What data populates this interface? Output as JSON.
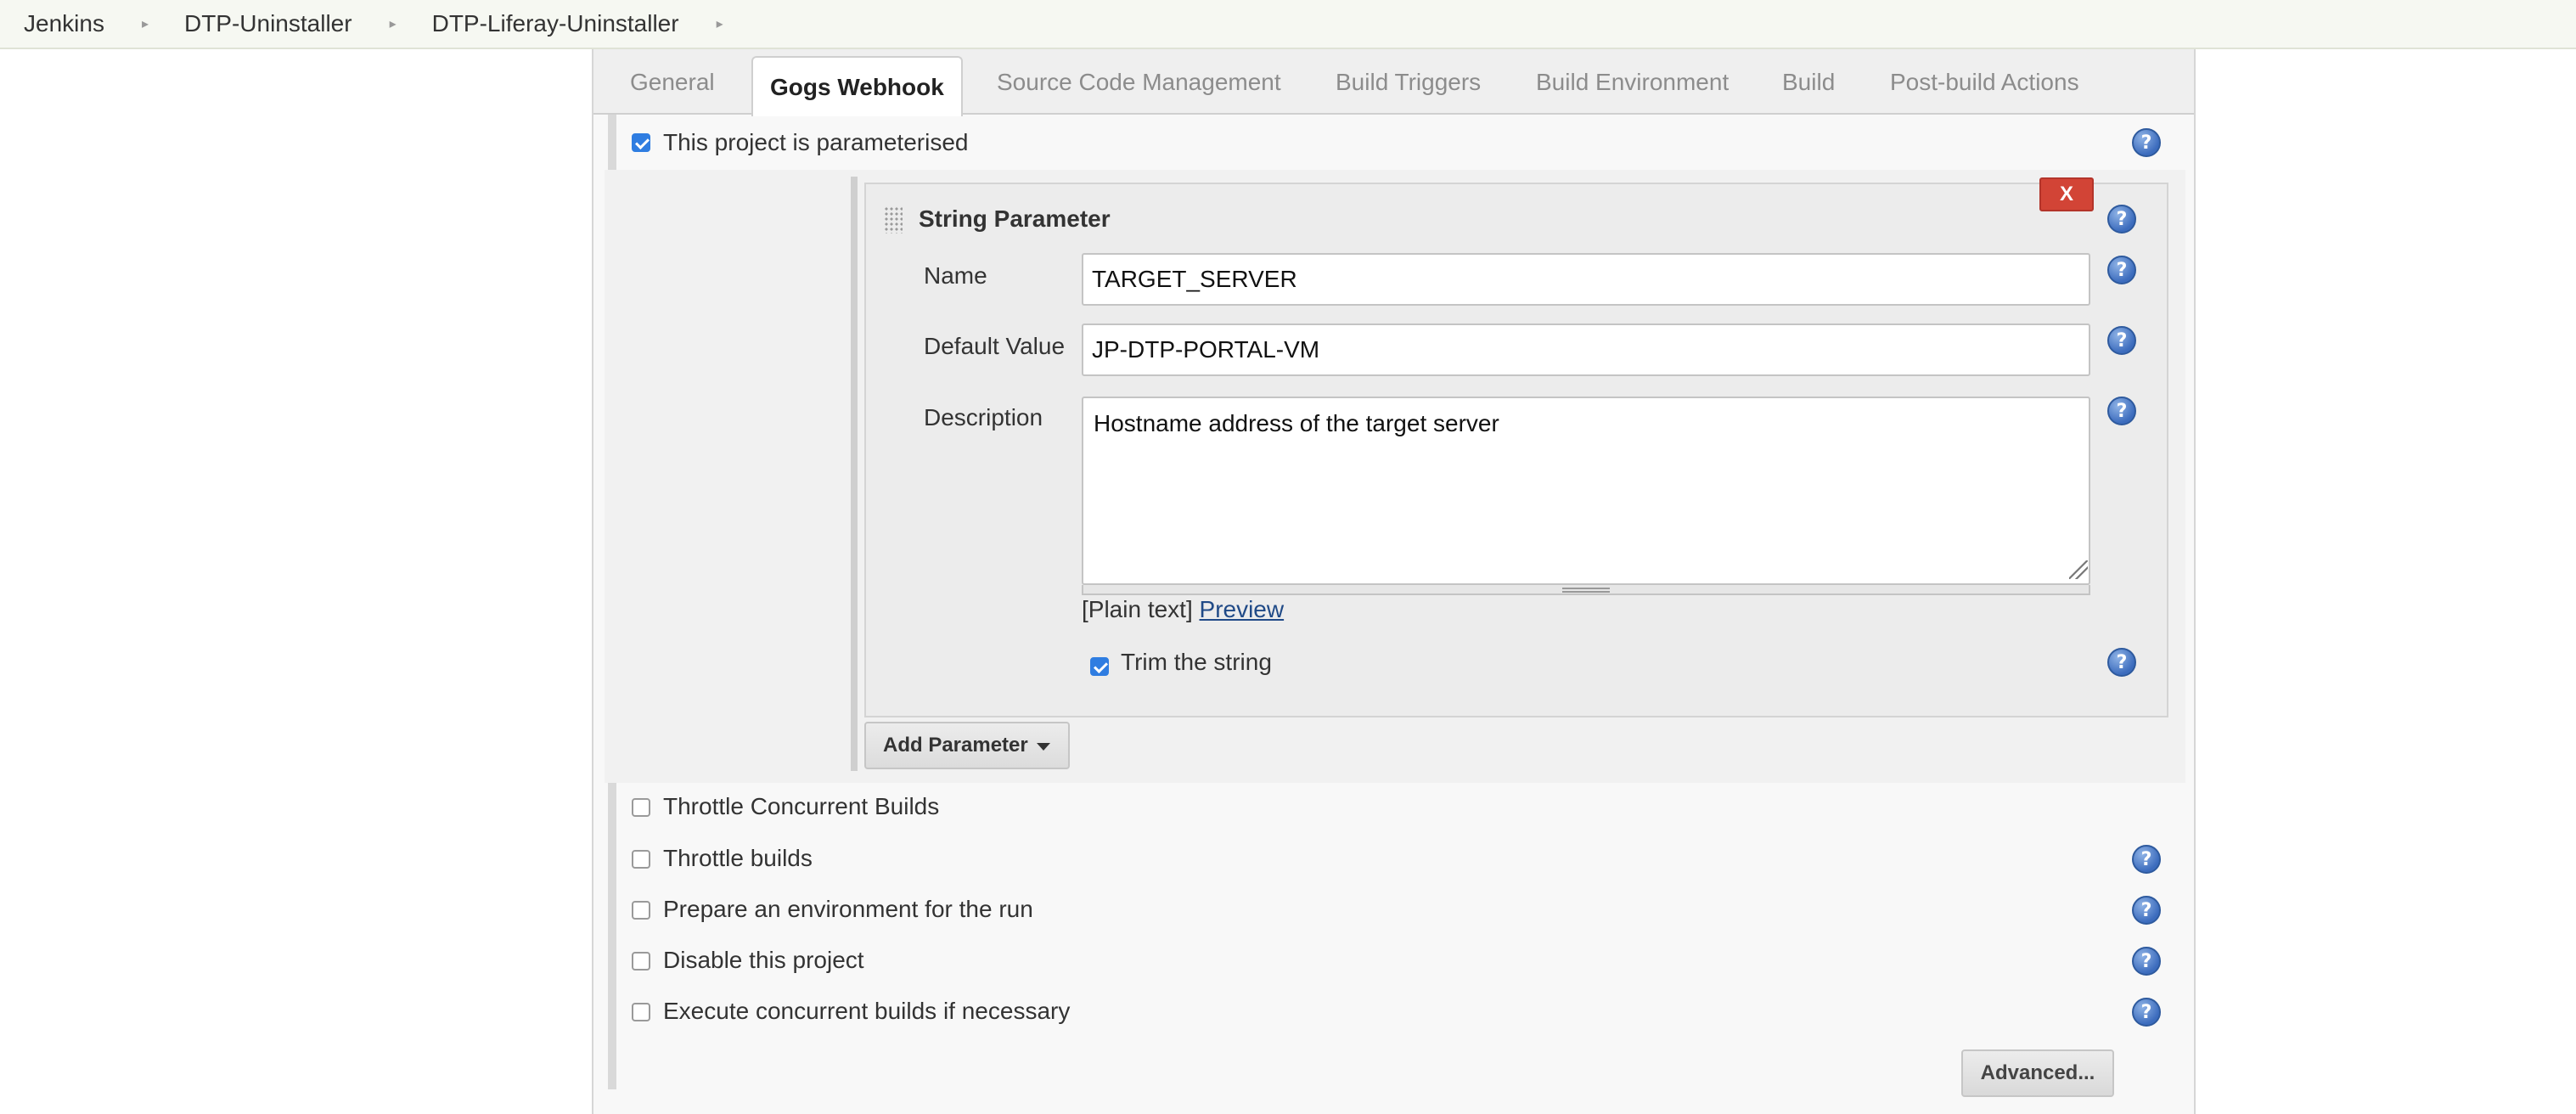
{
  "breadcrumb": {
    "items": [
      "Jenkins",
      "DTP-Uninstaller",
      "DTP-Liferay-Uninstaller"
    ],
    "separator": "▸"
  },
  "tabs": [
    {
      "label": "General",
      "active": false
    },
    {
      "label": "Gogs Webhook",
      "active": true
    },
    {
      "label": "Source Code Management",
      "active": false
    },
    {
      "label": "Build Triggers",
      "active": false
    },
    {
      "label": "Build Environment",
      "active": false
    },
    {
      "label": "Build",
      "active": false
    },
    {
      "label": "Post-build Actions",
      "active": false
    }
  ],
  "parameterised": {
    "label": "This project is parameterised",
    "checked": true
  },
  "string_parameter": {
    "title": "String Parameter",
    "delete_label": "X",
    "name_label": "Name",
    "name_value": "TARGET_SERVER",
    "default_label": "Default Value",
    "default_value": "JP-DTP-PORTAL-VM",
    "description_label": "Description",
    "description_value": "Hostname address of the target server",
    "plain_text": "[Plain text]",
    "preview_link": "Preview",
    "trim_label": "Trim the string",
    "trim_checked": true
  },
  "add_parameter_label": "Add Parameter",
  "options": [
    {
      "label": "Throttle Concurrent Builds",
      "checked": false,
      "help": false
    },
    {
      "label": "Throttle builds",
      "checked": false,
      "help": true
    },
    {
      "label": "Prepare an environment for the run",
      "checked": false,
      "help": true
    },
    {
      "label": "Disable this project",
      "checked": false,
      "help": true
    },
    {
      "label": "Execute concurrent builds if necessary",
      "checked": false,
      "help": true
    }
  ],
  "advanced_label": "Advanced...",
  "help_glyph": "?",
  "colors": {
    "accent": "#2f7de1",
    "danger": "#d24436",
    "link": "#204a87"
  }
}
